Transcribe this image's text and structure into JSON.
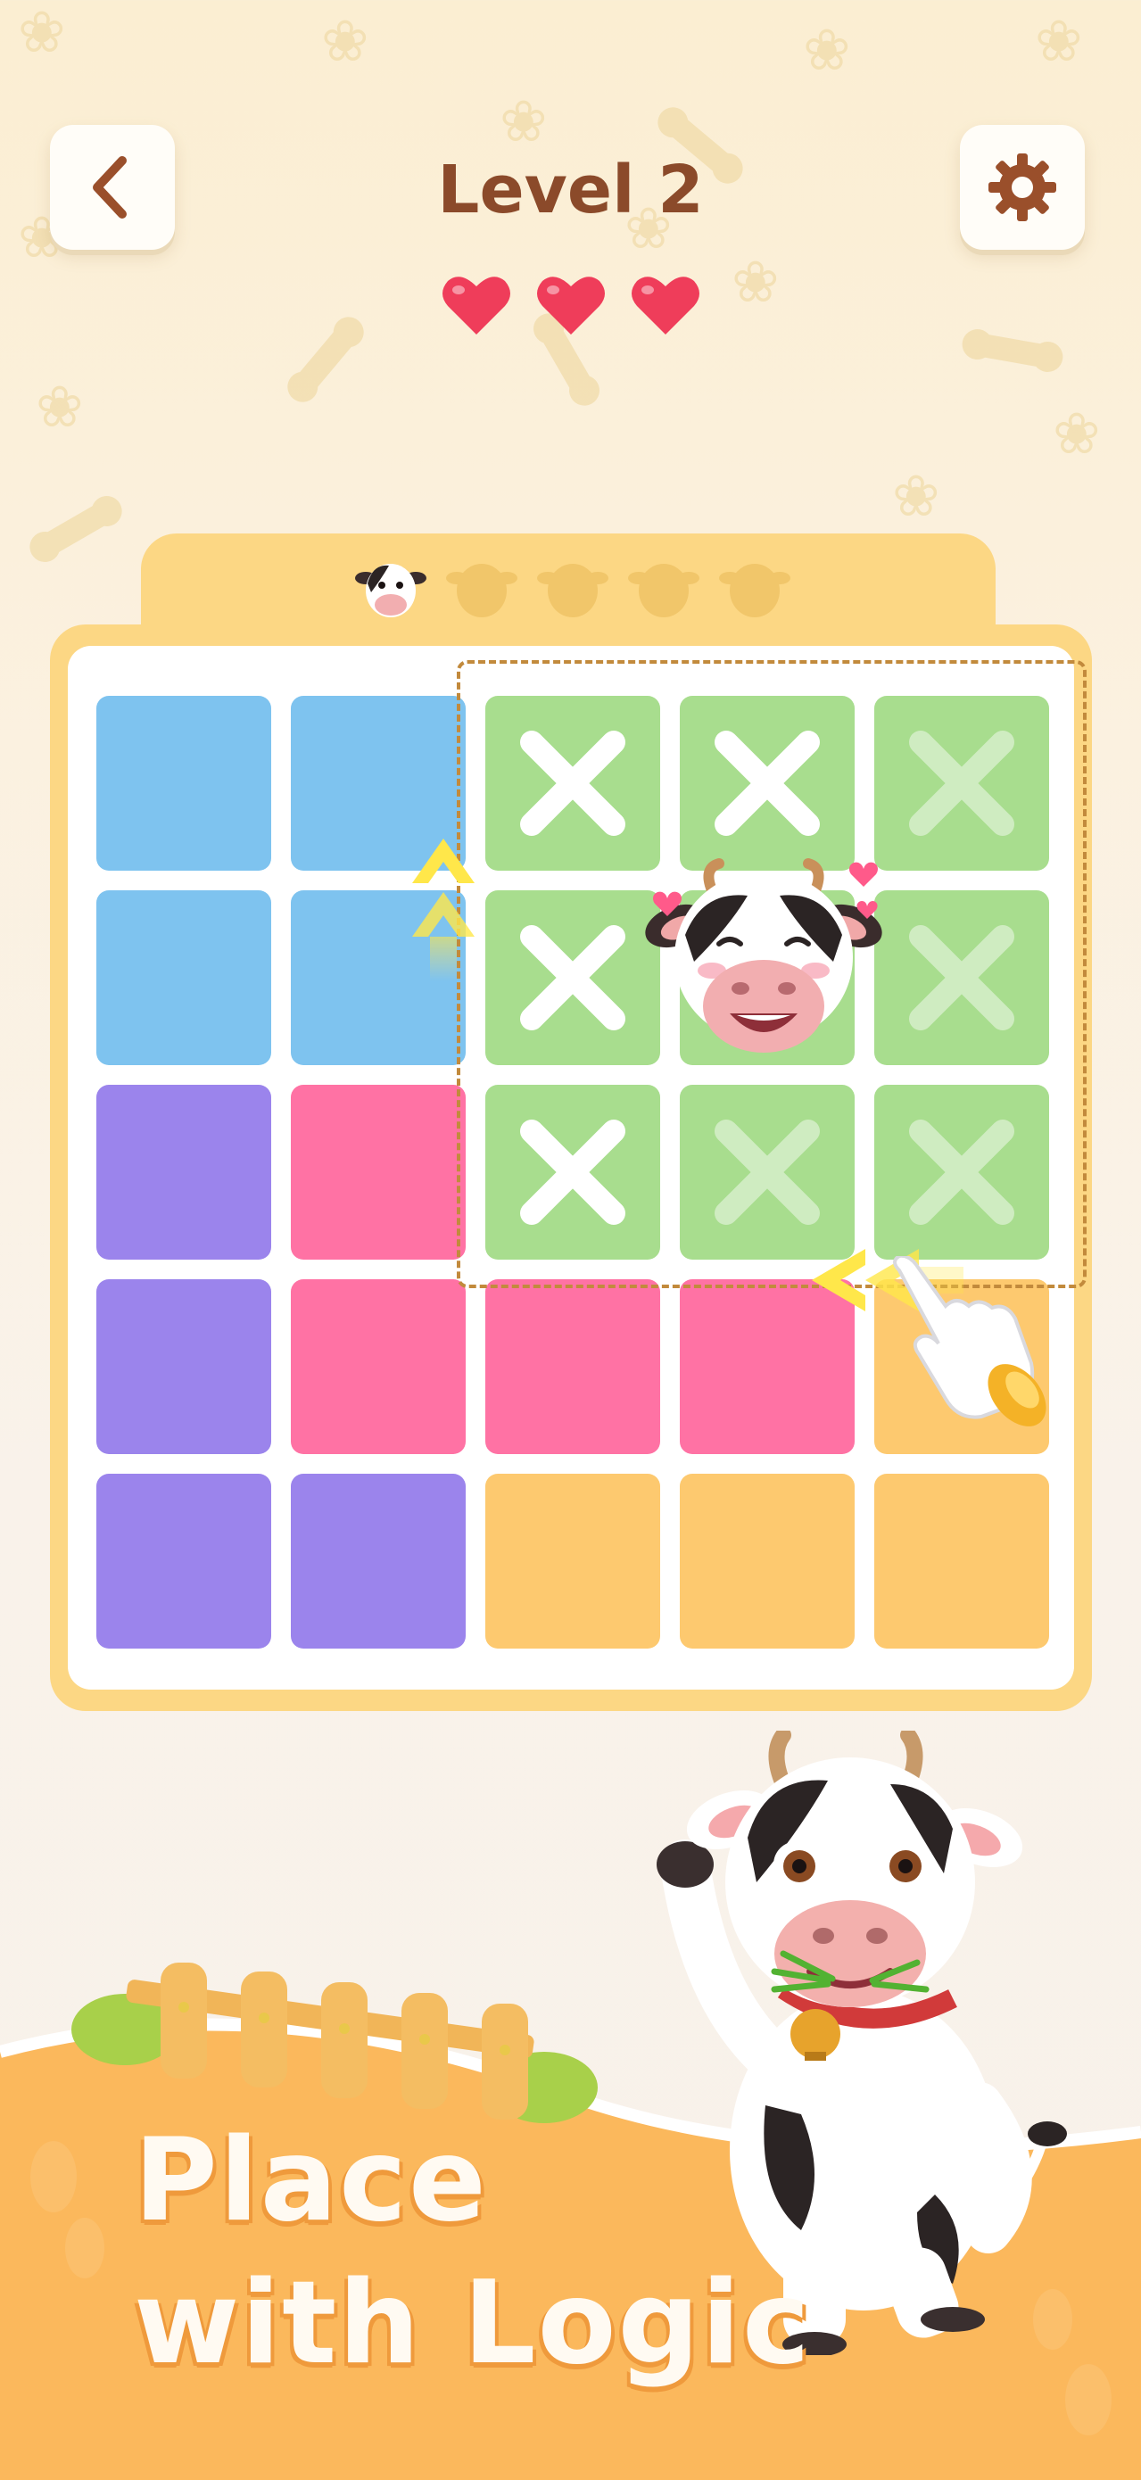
{
  "header": {
    "back_icon": "chevron-left-icon",
    "settings_icon": "gear-icon",
    "title": "Level 2",
    "lives": 3,
    "heart_color": "#ef3d5a"
  },
  "progress": {
    "collected": 1,
    "total": 5
  },
  "board": {
    "rows": 5,
    "cols": 5,
    "colors": {
      "blue": "#7ec3ef",
      "purple": "#9b84ec",
      "pink": "#ff72a4",
      "yellow": "#fdc96f",
      "green": "#a8dd8e"
    },
    "grid": [
      [
        "blue",
        "blue",
        "green",
        "green",
        "green"
      ],
      [
        "blue",
        "blue",
        "green",
        "green",
        "green"
      ],
      [
        "purple",
        "pink",
        "green",
        "green",
        "green"
      ],
      [
        "purple",
        "pink",
        "pink",
        "pink",
        "yellow"
      ],
      [
        "purple",
        "purple",
        "yellow",
        "yellow",
        "yellow"
      ]
    ],
    "crossed": [
      [
        0,
        2
      ],
      [
        0,
        3
      ],
      [
        0,
        4
      ],
      [
        1,
        2
      ],
      [
        1,
        4
      ],
      [
        2,
        2
      ],
      [
        2,
        3
      ],
      [
        2,
        4
      ]
    ]
  },
  "slogan": {
    "line1": "Place",
    "line2": "with Logic"
  },
  "theme": {
    "board_frame": "#fcd784",
    "banner": "#fbb85c"
  }
}
